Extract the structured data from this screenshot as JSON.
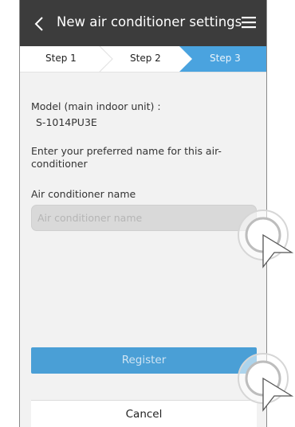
{
  "header": {
    "title": "New air conditioner settings",
    "back_icon": "chevron-left-icon",
    "menu_icon": "hamburger-menu-icon"
  },
  "steps": [
    {
      "label": "Step 1",
      "active": false
    },
    {
      "label": "Step 2",
      "active": false
    },
    {
      "label": "Step 3",
      "active": true
    }
  ],
  "form": {
    "model_label": "Model (main indoor unit) :",
    "model_value": "S-1014PU3E",
    "prompt": "Enter your preferred name for this air-conditioner",
    "name_label": "Air conditioner name",
    "name_placeholder": "Air conditioner name",
    "name_value": ""
  },
  "actions": {
    "register_label": "Register",
    "cancel_label": "Cancel"
  },
  "colors": {
    "titlebar": "#3c3c3c",
    "active_step": "#4aa3df",
    "register": "#4a9fd6"
  },
  "pointer_icon": "tap-pointer-icon"
}
